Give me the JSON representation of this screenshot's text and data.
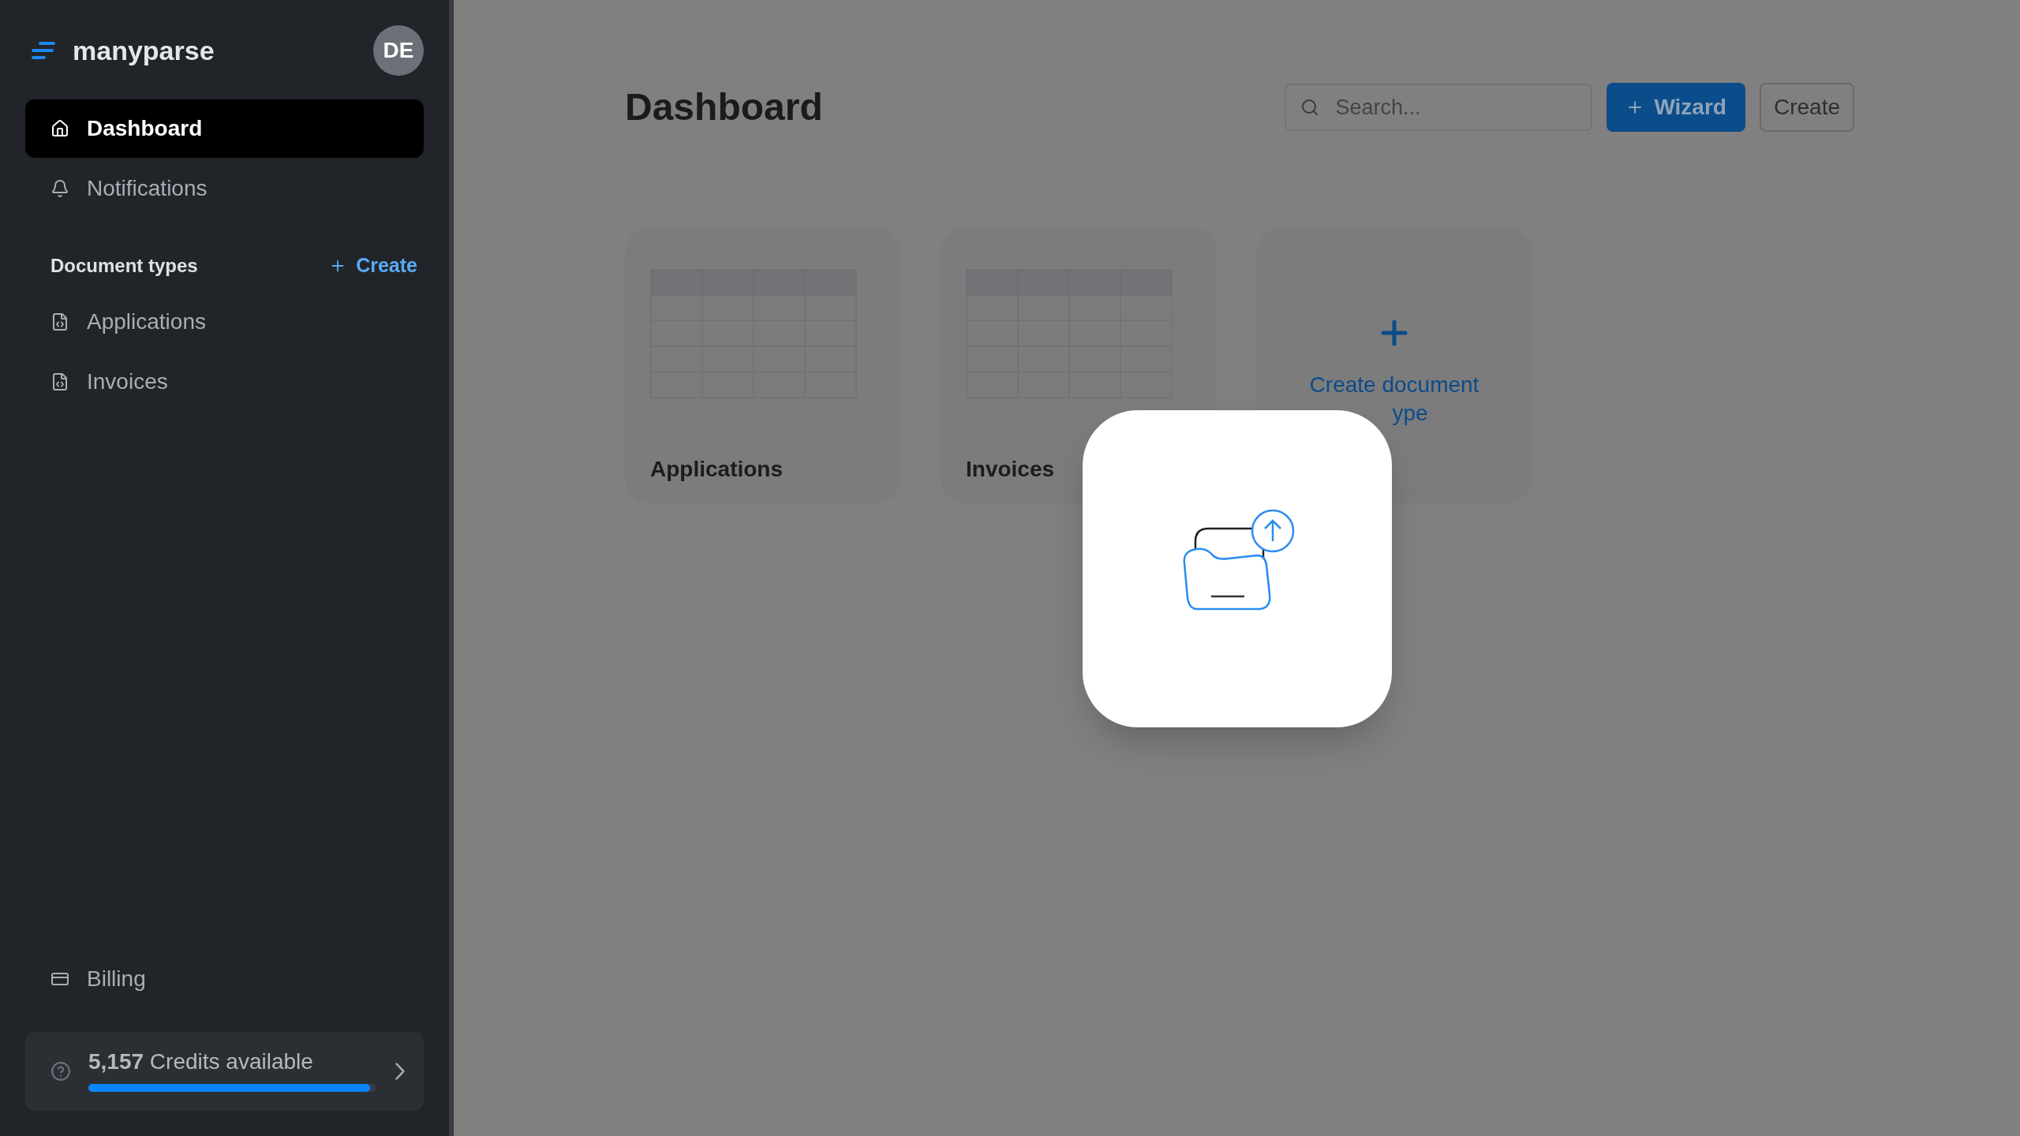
{
  "sidebar": {
    "brand": "manyparse",
    "avatar": "DE",
    "nav": [
      {
        "label": "Dashboard",
        "selected": true
      },
      {
        "label": "Notifications",
        "selected": false
      }
    ],
    "section": {
      "title": "Document types",
      "action": "Create"
    },
    "document_types": [
      {
        "label": "Applications",
        "selected": false
      },
      {
        "label": "Invoices",
        "selected": false
      }
    ],
    "billing": {
      "label": "Billing"
    },
    "credits": {
      "amount": "5,157",
      "label": "Credits available",
      "level": 0.98
    }
  },
  "main": {
    "title": "Dashboard",
    "search": {
      "placeholder": "Search..."
    },
    "buttons": [
      {
        "label": "Wizard",
        "kind": "primary"
      },
      {
        "label": "Create",
        "kind": "secondary"
      }
    ],
    "cards": [
      {
        "kind": "document",
        "label": "Applications"
      },
      {
        "kind": "document",
        "label": "Invoices"
      },
      {
        "kind": "create",
        "lines": [
          "Create document",
          "ype"
        ]
      }
    ]
  },
  "modal": {
    "kind": "upload"
  }
}
